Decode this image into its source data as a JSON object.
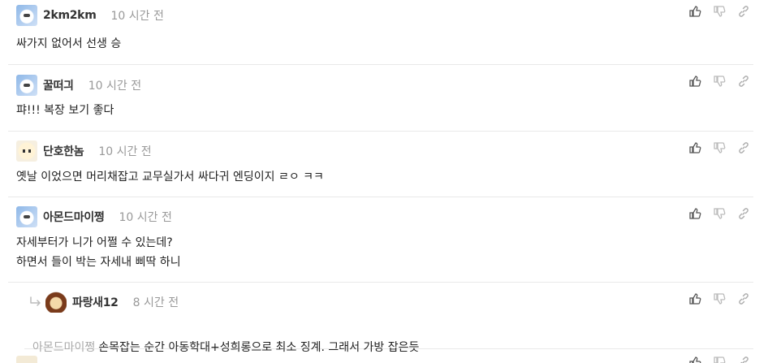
{
  "comments": [
    {
      "nick": "2km2km",
      "time": "10 시간 전",
      "text": "싸가지 없어서 선생 승"
    },
    {
      "nick": "꿀떠긔",
      "time": "10 시간 전",
      "text": "퍄!!! 복장 보기 좋다"
    },
    {
      "nick": "단호한놈",
      "time": "10 시간 전",
      "text": "옛날 이었으면 머리채잡고 교무실가서 싸다귀 엔딩이지 ㄹㅇ ㅋㅋ"
    },
    {
      "nick": "아몬드마이쩡",
      "time": "10 시간 전",
      "text": "자세부터가 니가 어쩔 수 있는데?\n하면서 들이 박는 자세내 삐딱 하니"
    }
  ],
  "reply": {
    "nick": "파랑새12",
    "time": "8 시간 전",
    "mention": "아몬드마이쩡",
    "text": "손목잡는 순간 아동학대+성희롱으로 최소 징계. 그래서 가방 잡은듯"
  },
  "icons": {
    "like": "thumbs-up-icon",
    "dislike": "thumbs-down-icon",
    "link": "link-icon"
  }
}
